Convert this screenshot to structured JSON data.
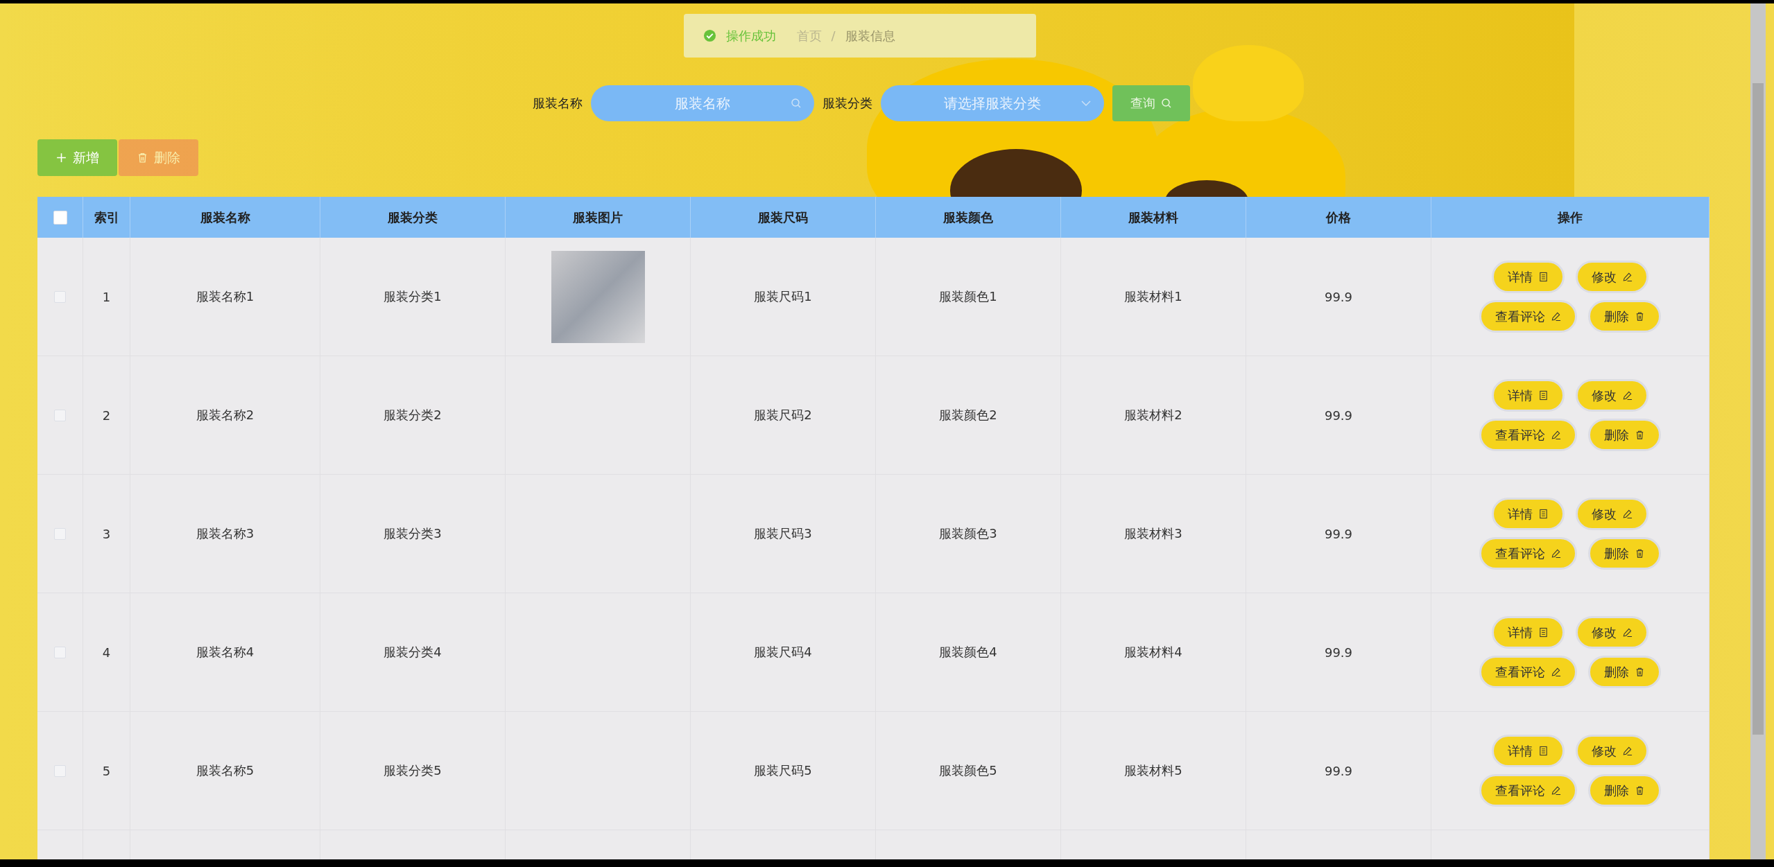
{
  "toast": {
    "message": "操作成功"
  },
  "breadcrumb": [
    "首页",
    "/",
    "服装信息"
  ],
  "search": [
    {
      "label": "服装名称",
      "kind": "input",
      "placeholder": "服装名称"
    },
    {
      "label": "服装分类",
      "kind": "select",
      "placeholder": "请选择服装分类"
    }
  ],
  "search_button": "查询",
  "toolbar": [
    {
      "label": "新增",
      "kind": "add",
      "disabled": false
    },
    {
      "label": "删除",
      "kind": "delete",
      "disabled": true
    }
  ],
  "table": {
    "all_checked": false,
    "columns": [
      "索引",
      "服装名称",
      "服装分类",
      "服装图片",
      "服装尺码",
      "服装颜色",
      "服装材料",
      "价格",
      "操作"
    ],
    "rows": [
      {
        "checked": false,
        "index": "1",
        "name": "服装名称1",
        "category": "服装分类1",
        "has_photo": true,
        "size": "服装尺码1",
        "garment_color": "服装颜色1",
        "material": "服装材料1",
        "price": "99.9",
        "actions": [
          {
            "label": "详情",
            "kind": "detail"
          },
          {
            "label": "修改",
            "kind": "edit"
          },
          {
            "label": "查看评论",
            "kind": "comments"
          },
          {
            "label": "删除",
            "kind": "delete"
          }
        ]
      },
      {
        "checked": false,
        "index": "2",
        "name": "服装名称2",
        "category": "服装分类2",
        "has_photo": false,
        "size": "服装尺码2",
        "garment_color": "服装颜色2",
        "material": "服装材料2",
        "price": "99.9",
        "actions": [
          {
            "label": "详情",
            "kind": "detail"
          },
          {
            "label": "修改",
            "kind": "edit"
          },
          {
            "label": "查看评论",
            "kind": "comments"
          },
          {
            "label": "删除",
            "kind": "delete"
          }
        ]
      },
      {
        "checked": false,
        "index": "3",
        "name": "服装名称3",
        "category": "服装分类3",
        "has_photo": false,
        "size": "服装尺码3",
        "garment_color": "服装颜色3",
        "material": "服装材料3",
        "price": "99.9",
        "actions": [
          {
            "label": "详情",
            "kind": "detail"
          },
          {
            "label": "修改",
            "kind": "edit"
          },
          {
            "label": "查看评论",
            "kind": "comments"
          },
          {
            "label": "删除",
            "kind": "delete"
          }
        ]
      },
      {
        "checked": false,
        "index": "4",
        "name": "服装名称4",
        "category": "服装分类4",
        "has_photo": false,
        "size": "服装尺码4",
        "garment_color": "服装颜色4",
        "material": "服装材料4",
        "price": "99.9",
        "actions": [
          {
            "label": "详情",
            "kind": "detail"
          },
          {
            "label": "修改",
            "kind": "edit"
          },
          {
            "label": "查看评论",
            "kind": "comments"
          },
          {
            "label": "删除",
            "kind": "delete"
          }
        ]
      },
      {
        "checked": false,
        "index": "5",
        "name": "服装名称5",
        "category": "服装分类5",
        "has_photo": false,
        "size": "服装尺码5",
        "garment_color": "服装颜色5",
        "material": "服装材料5",
        "price": "99.9",
        "actions": [
          {
            "label": "详情",
            "kind": "detail"
          },
          {
            "label": "修改",
            "kind": "edit"
          },
          {
            "label": "查看评论",
            "kind": "comments"
          },
          {
            "label": "删除",
            "kind": "delete"
          }
        ]
      }
    ]
  }
}
